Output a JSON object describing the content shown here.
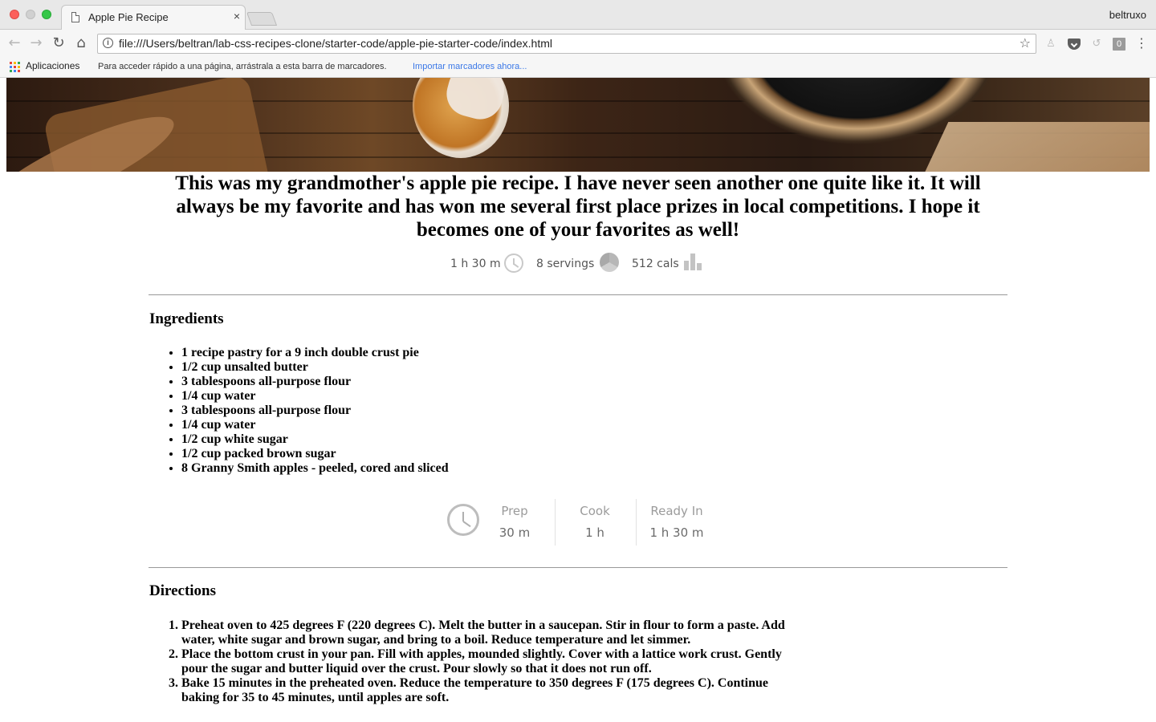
{
  "browser": {
    "tab_title": "Apple Pie Recipe",
    "tab_close": "×",
    "profile_name": "beltruxo",
    "url": "file:///Users/beltran/lab-css-recipes-clone/starter-code/apple-pie-starter-code/index.html",
    "bookmarks": {
      "apps_label": "Aplicaciones",
      "hint": "Para acceder rápido a una página, arrástrala a esta barra de marcadores.",
      "import_link": "Importar marcadores ahora..."
    }
  },
  "recipe": {
    "intro": "This was my grandmother's apple pie recipe. I have never seen another one quite like it. It will always be my favorite and has won me several first place prizes in local competitions. I hope it becomes one of your favorites as well!",
    "meta": {
      "time": "1 h 30 m",
      "servings": "8 servings",
      "calories": "512 cals"
    },
    "ingredients_heading": "Ingredients",
    "ingredients": [
      "1 recipe pastry for a 9 inch double crust pie",
      "1/2 cup unsalted butter",
      "3 tablespoons all-purpose flour",
      "1/4 cup water",
      "3 tablespoons all-purpose flour",
      "1/4 cup water",
      "1/2 cup white sugar",
      "1/2 cup packed brown sugar",
      "8 Granny Smith apples - peeled, cored and sliced"
    ],
    "times": {
      "prep_label": "Prep",
      "prep_value": "30 m",
      "cook_label": "Cook",
      "cook_value": "1 h",
      "ready_label": "Ready In",
      "ready_value": "1 h 30 m"
    },
    "directions_heading": "Directions",
    "directions": [
      "Preheat oven to 425 degrees F (220 degrees C). Melt the butter in a saucepan. Stir in flour to form a paste. Add water, white sugar and brown sugar, and bring to a boil. Reduce temperature and let simmer.",
      "Place the bottom crust in your pan. Fill with apples, mounded slightly. Cover with a lattice work crust. Gently pour the sugar and butter liquid over the crust. Pour slowly so that it does not run off.",
      "Bake 15 minutes in the preheated oven. Reduce the temperature to 350 degrees F (175 degrees C). Continue baking for 35 to 45 minutes, until apples are soft."
    ]
  }
}
